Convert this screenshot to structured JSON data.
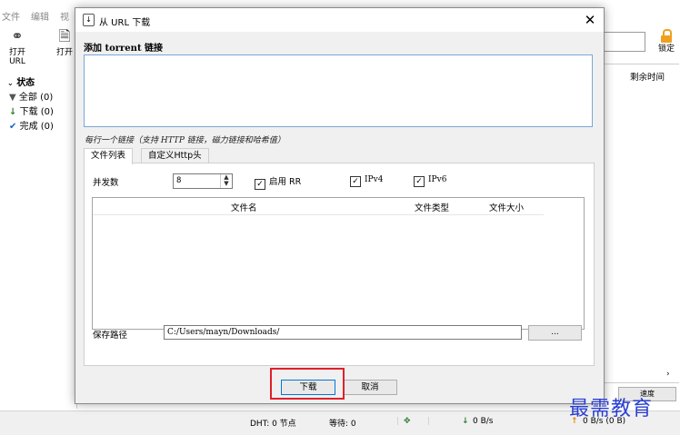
{
  "app": {
    "menu": [
      "文件",
      "编辑",
      "视"
    ],
    "toolbar": {
      "open_url": "打开 URL",
      "open": "打开"
    },
    "lock_label": "锁定",
    "sidebar": {
      "header": "状态",
      "items": [
        {
          "label": "全部 (0)",
          "icon": "filter-icon"
        },
        {
          "label": "下载 (0)",
          "icon": "download-arrow-icon"
        },
        {
          "label": "完成 (0)",
          "icon": "checkmark-icon"
        }
      ]
    },
    "right_column_header": "剩余时间",
    "right_bottom_label": "速度",
    "status": {
      "dht": "DHT: 0 节点",
      "waiting": "等待: 0",
      "down_speed": "0 B/s",
      "up_speed": "0 B/s (0 B)"
    }
  },
  "dialog": {
    "title": "从 URL 下载",
    "section_label": "添加 torrent 链接",
    "url_value": "",
    "hint": "每行一个链接（支持 HTTP 链接，磁力链接和哈希值）",
    "tabs": [
      {
        "label": "文件列表",
        "active": true
      },
      {
        "label": "自定义Http头",
        "active": false
      }
    ],
    "concurrency_label": "并发数",
    "concurrency_value": "8",
    "checkboxes": {
      "rr": "启用 RR",
      "ipv4": "IPv4",
      "ipv6": "IPv6"
    },
    "columns": {
      "name": "文件名",
      "type": "文件类型",
      "size": "文件大小"
    },
    "save_path_label": "保存路径",
    "save_path_value": "C:/Users/mayn/Downloads/",
    "browse_label": "...",
    "download_button": "下载",
    "cancel_button": "取消"
  },
  "watermark": "最需教育",
  "colors": {
    "accent": "#0078d7",
    "highlight_frame": "#e0202a",
    "watermark": "#2a3fd0",
    "lock_icon": "#f0a020"
  }
}
